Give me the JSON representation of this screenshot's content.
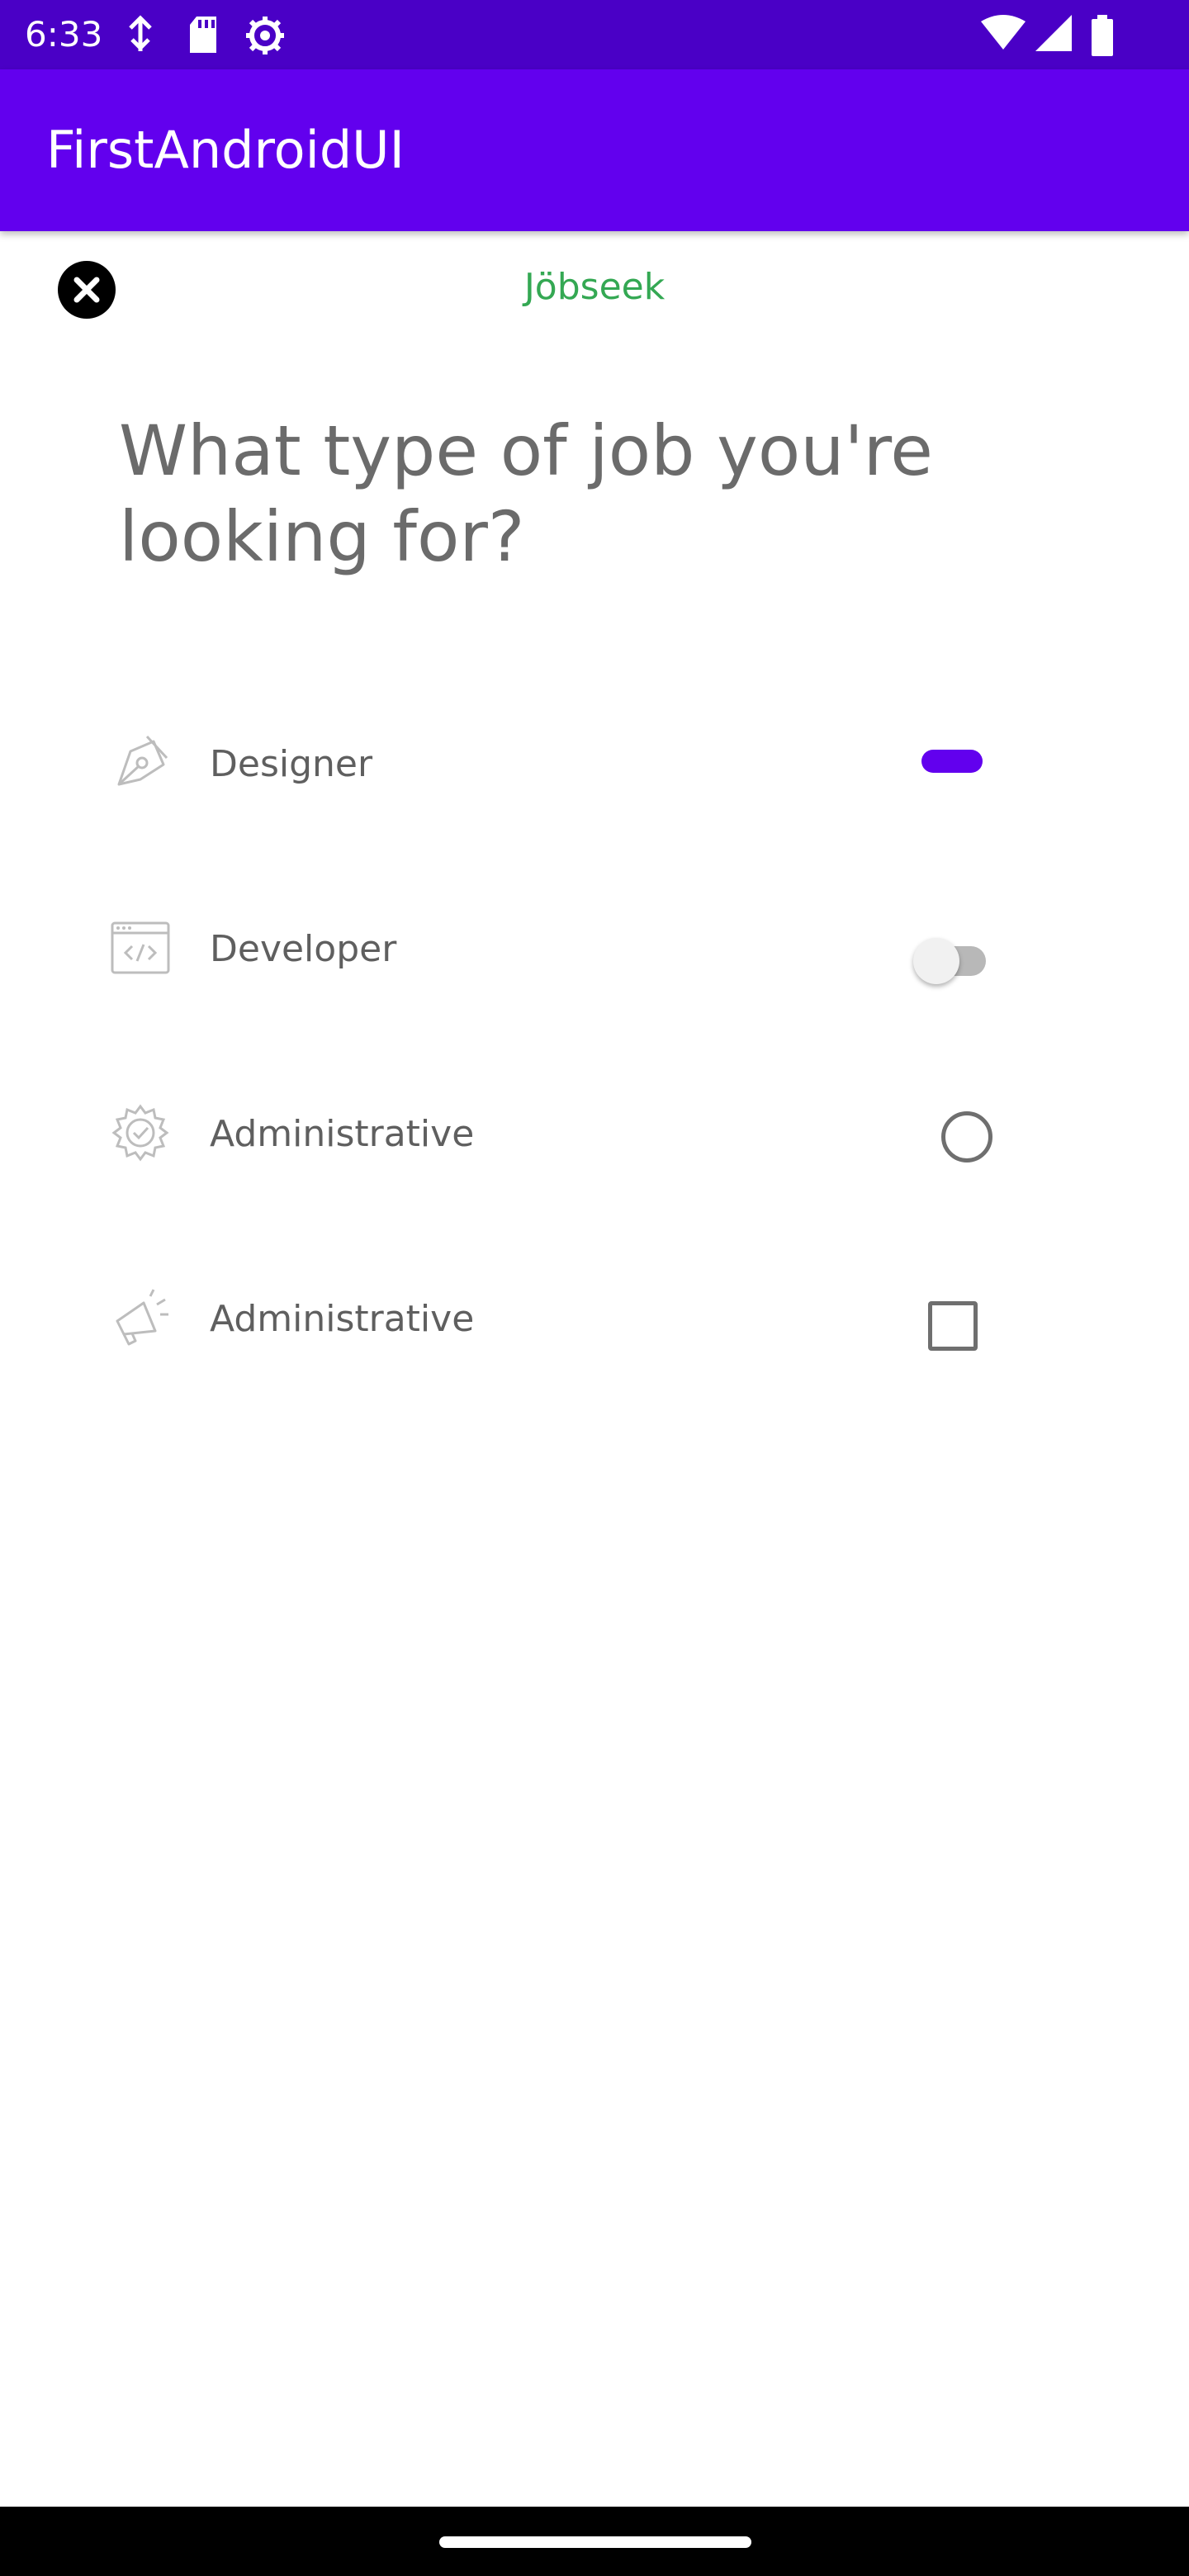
{
  "status_bar": {
    "time": "6:33",
    "left_icons": [
      "data-saver-icon",
      "sd-card-icon",
      "settings-gear-icon"
    ],
    "right_icons": [
      "wifi-icon",
      "signal-icon",
      "battery-icon"
    ],
    "background": "#4a00c6"
  },
  "app_bar": {
    "title": "FirstAndroidUI",
    "background": "#6200ee"
  },
  "header": {
    "brand": "Jöbseek",
    "brand_color": "#34a853",
    "close_icon": "close-icon"
  },
  "question": "What type of job you're looking for?",
  "jobs": [
    {
      "label": "Designer",
      "icon": "pen-tool-icon",
      "control": "switch",
      "state": "on"
    },
    {
      "label": "Developer",
      "icon": "code-window-icon",
      "control": "switch",
      "state": "off"
    },
    {
      "label": "Administrative",
      "icon": "gear-check-icon",
      "control": "radio",
      "state": "unchecked"
    },
    {
      "label": "Administrative",
      "icon": "megaphone-icon",
      "control": "checkbox",
      "state": "unchecked"
    }
  ],
  "accent_color": "#6200ee"
}
